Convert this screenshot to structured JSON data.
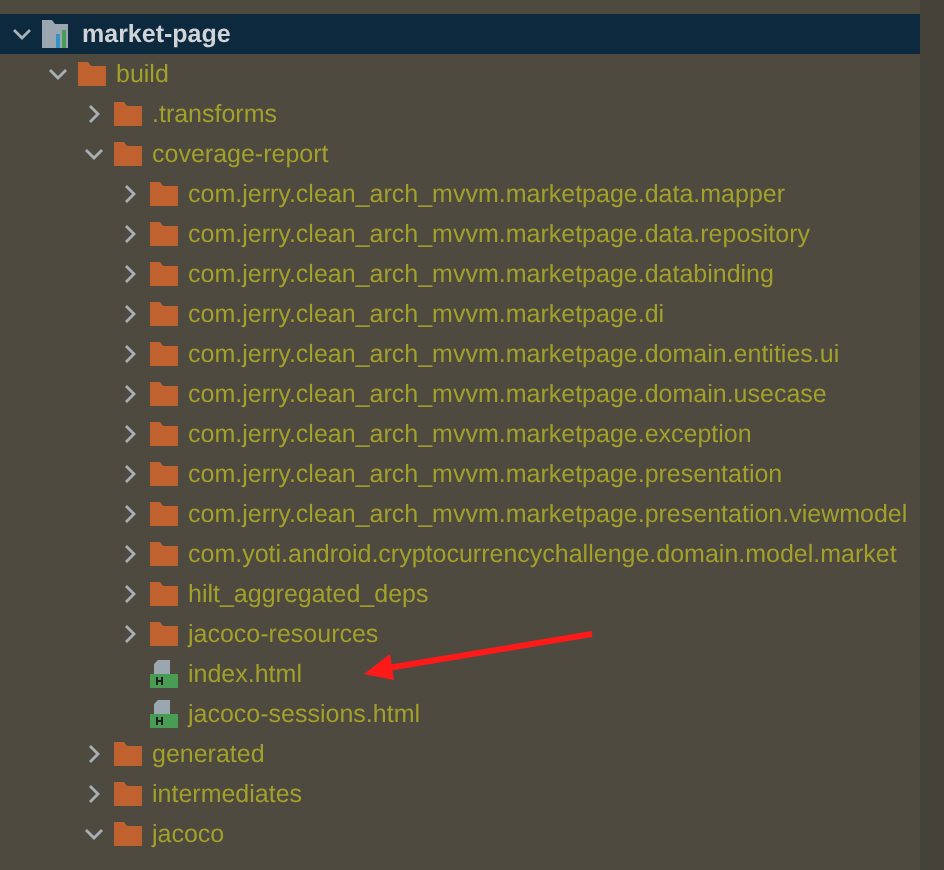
{
  "tree": [
    {
      "label": "market-page",
      "kind": "module",
      "expanded": true,
      "selected": true,
      "children": [
        {
          "label": "build",
          "kind": "folder",
          "expanded": true,
          "selected": false,
          "children": [
            {
              "label": ".transforms",
              "kind": "folder",
              "expanded": false,
              "selected": false
            },
            {
              "label": "coverage-report",
              "kind": "folder",
              "expanded": true,
              "selected": false,
              "children": [
                {
                  "label": "com.jerry.clean_arch_mvvm.marketpage.data.mapper",
                  "kind": "folder",
                  "expanded": false,
                  "selected": false
                },
                {
                  "label": "com.jerry.clean_arch_mvvm.marketpage.data.repository",
                  "kind": "folder",
                  "expanded": false,
                  "selected": false
                },
                {
                  "label": "com.jerry.clean_arch_mvvm.marketpage.databinding",
                  "kind": "folder",
                  "expanded": false,
                  "selected": false
                },
                {
                  "label": "com.jerry.clean_arch_mvvm.marketpage.di",
                  "kind": "folder",
                  "expanded": false,
                  "selected": false
                },
                {
                  "label": "com.jerry.clean_arch_mvvm.marketpage.domain.entities.ui",
                  "kind": "folder",
                  "expanded": false,
                  "selected": false
                },
                {
                  "label": "com.jerry.clean_arch_mvvm.marketpage.domain.usecase",
                  "kind": "folder",
                  "expanded": false,
                  "selected": false
                },
                {
                  "label": "com.jerry.clean_arch_mvvm.marketpage.exception",
                  "kind": "folder",
                  "expanded": false,
                  "selected": false
                },
                {
                  "label": "com.jerry.clean_arch_mvvm.marketpage.presentation",
                  "kind": "folder",
                  "expanded": false,
                  "selected": false
                },
                {
                  "label": "com.jerry.clean_arch_mvvm.marketpage.presentation.viewmodel",
                  "kind": "folder",
                  "expanded": false,
                  "selected": false
                },
                {
                  "label": "com.yoti.android.cryptocurrencychallenge.domain.model.market",
                  "kind": "folder",
                  "expanded": false,
                  "selected": false
                },
                {
                  "label": "hilt_aggregated_deps",
                  "kind": "folder",
                  "expanded": false,
                  "selected": false
                },
                {
                  "label": "jacoco-resources",
                  "kind": "folder",
                  "expanded": false,
                  "selected": false
                },
                {
                  "label": "index.html",
                  "kind": "html",
                  "selected": false
                },
                {
                  "label": "jacoco-sessions.html",
                  "kind": "html",
                  "selected": false
                }
              ]
            },
            {
              "label": "generated",
              "kind": "folder",
              "expanded": false,
              "selected": false
            },
            {
              "label": "intermediates",
              "kind": "folder",
              "expanded": false,
              "selected": false
            },
            {
              "label": "jacoco",
              "kind": "folder",
              "expanded": true,
              "selected": false
            }
          ]
        }
      ]
    }
  ]
}
